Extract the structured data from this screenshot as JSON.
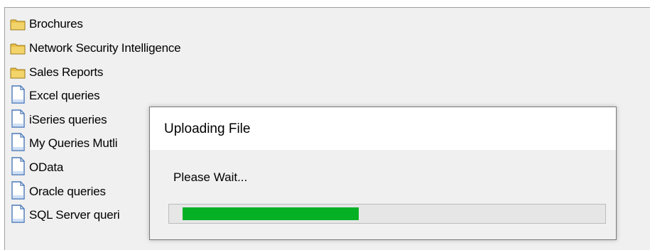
{
  "file_list": {
    "items": [
      {
        "label": "Brochures",
        "icon": "folder-icon"
      },
      {
        "label": "Network Security Intelligence",
        "icon": "folder-icon"
      },
      {
        "label": "Sales Reports",
        "icon": "folder-icon"
      },
      {
        "label": "Excel queries",
        "icon": "document-icon"
      },
      {
        "label": "iSeries queries",
        "icon": "document-icon"
      },
      {
        "label": "My Queries Mutli",
        "icon": "document-icon"
      },
      {
        "label": "OData",
        "icon": "document-icon"
      },
      {
        "label": "Oracle queries",
        "icon": "document-icon"
      },
      {
        "label": "SQL Server queri",
        "icon": "document-icon"
      }
    ]
  },
  "dialog": {
    "title": "Uploading File",
    "message": "Please Wait...",
    "progress_fraction": 0.43
  },
  "colors": {
    "progress_fill": "#06b025",
    "folder": "#e8c04a",
    "document_outline": "#4a78b8"
  }
}
